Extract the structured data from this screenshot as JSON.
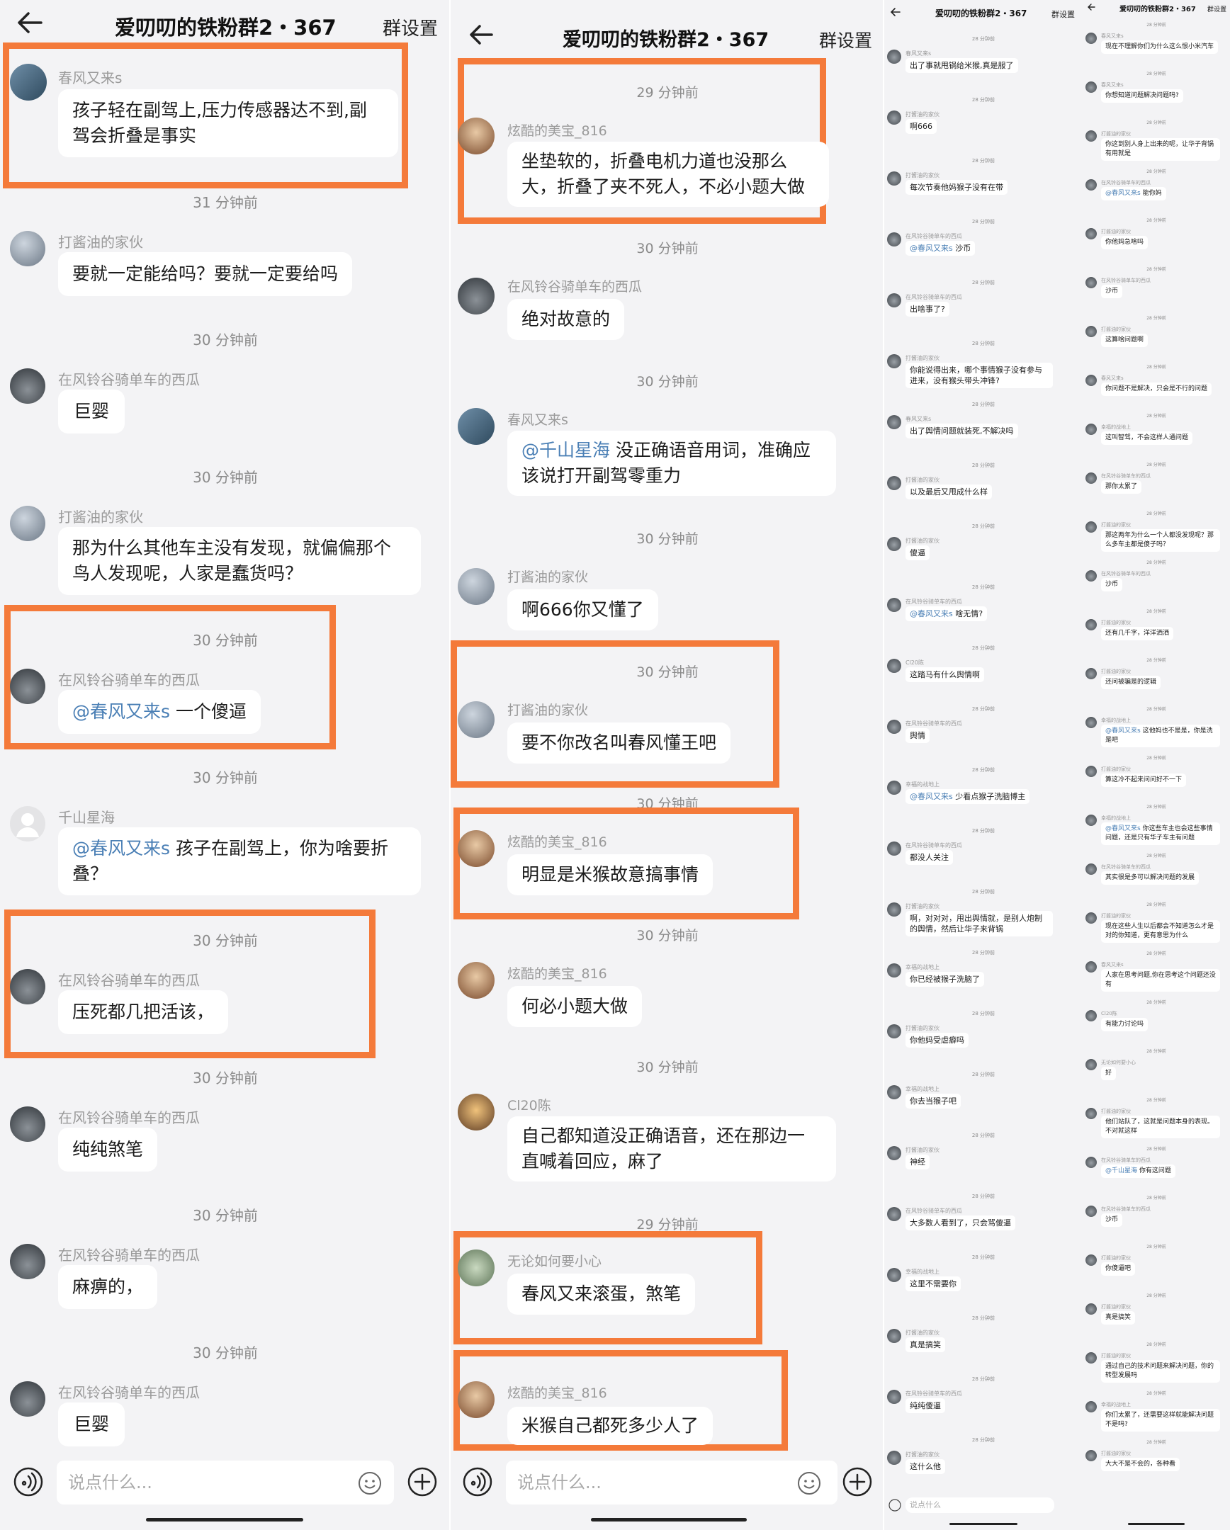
{
  "group": {
    "title": "爱叨叨的铁粉群2・367",
    "settings": "群设置"
  },
  "input": {
    "placeholder": "说点什么..."
  },
  "colors": {
    "highlight": "#f47a3a",
    "mention": "#4a7fb5",
    "bubble": "#ffffff",
    "background": "#f3f3f5"
  },
  "panel1": {
    "m1": {
      "sender": "春风又来s",
      "text": "孩子轻在副驾上,压力传感器达不到,副驾会折叠是事实"
    },
    "t1": "31 分钟前",
    "m2": {
      "sender": "打酱油的家伙",
      "text": "要就一定能给吗？要就一定要给吗"
    },
    "t2": "30 分钟前",
    "m3": {
      "sender": "在风铃谷骑单车的西瓜",
      "text": "巨婴"
    },
    "t3": "30 分钟前",
    "m4": {
      "sender": "打酱油的家伙",
      "text": "那为什么其他车主没有发现，就偏偏那个鸟人发现呢，人家是蠢货吗？"
    },
    "t4": "30 分钟前",
    "m5": {
      "sender": "在风铃谷骑单车的西瓜",
      "mention": "@春风又来s",
      "text": " 一个傻逼"
    },
    "t5": "30 分钟前",
    "m6": {
      "sender": "千山星海",
      "mention": "@春风又来s",
      "text": " 孩子在副驾上，你为啥要折叠？"
    },
    "t6": "30 分钟前",
    "m7": {
      "sender": "在风铃谷骑单车的西瓜",
      "text": "压死都几把活该，"
    },
    "t7": "30 分钟前",
    "m8": {
      "sender": "在风铃谷骑单车的西瓜",
      "text": "纯纯煞笔"
    },
    "t8": "30 分钟前",
    "m9": {
      "sender": "在风铃谷骑单车的西瓜",
      "text": "麻痹的，"
    },
    "t9": "30 分钟前",
    "m10": {
      "sender": "在风铃谷骑单车的西瓜",
      "text": "巨婴"
    }
  },
  "panel2": {
    "t1": "29 分钟前",
    "m1": {
      "sender": "炫酷的美宝_816",
      "text": "坐垫软的，折叠电机力道也没那么大，折叠了夹不死人，不必小题大做"
    },
    "t2": "30 分钟前",
    "m2": {
      "sender": "在风铃谷骑单车的西瓜",
      "text": "绝对故意的"
    },
    "t3": "30 分钟前",
    "m3": {
      "sender": "春风又来s",
      "mention": "@千山星海",
      "text": " 没正确语音用词，准确应该说打开副驾零重力"
    },
    "t4": "30 分钟前",
    "m4": {
      "sender": "打酱油的家伙",
      "text": "啊666你又懂了"
    },
    "t5": "30 分钟前",
    "m5": {
      "sender": "打酱油的家伙",
      "text": "要不你改名叫春风懂王吧"
    },
    "t6": "30 分钟前",
    "m6": {
      "sender": "炫酷的美宝_816",
      "text": "明显是米猴故意搞事情"
    },
    "t7": "30 分钟前",
    "m7": {
      "sender": "炫酷的美宝_816",
      "text": "何必小题大做"
    },
    "t8": "30 分钟前",
    "m8": {
      "sender": "Cl20陈",
      "text": "自己都知道没正确语音，还在那边一直喊着回应，麻了"
    },
    "t9": "29 分钟前",
    "m9": {
      "sender": "无论如何要小心",
      "text": "春风又来滚蛋，煞笔"
    },
    "m10": {
      "sender": "炫酷的美宝_816",
      "text": "米猴自己都死多少人了"
    }
  },
  "panel3": {
    "time": "28 分钟前",
    "items": [
      {
        "sender": "春风又来s",
        "text": "出了事就甩锅给米猴,真是服了"
      },
      {
        "sender": "打酱油的家伙",
        "text": "啊666"
      },
      {
        "sender": "打酱油的家伙",
        "text": "每次节奏他妈猴子没有在带"
      },
      {
        "sender": "在风铃谷骑单车的西瓜",
        "mention": "@春风又来s",
        "text": " 沙币"
      },
      {
        "sender": "在风铃谷骑单车的西瓜",
        "text": "出啥事了?"
      },
      {
        "sender": "打酱油的家伙",
        "text": "你能说得出来，哪个事情猴子没有参与进来，没有猴头带头冲锋?"
      },
      {
        "sender": "春风又来s",
        "text": "出了舆情问题就装死,不解决吗"
      },
      {
        "sender": "打酱油的家伙",
        "text": "以及最后又甩成什么样"
      },
      {
        "sender": "打酱油的家伙",
        "text": "傻逼"
      },
      {
        "sender": "在风铃谷骑单车的西瓜",
        "mention": "@春风又来s",
        "text": " 啥无情?"
      },
      {
        "sender": "Cl20陈",
        "text": "这踏马有什么舆情啊"
      },
      {
        "sender": "在风铃谷骑单车的西瓜",
        "text": "舆情"
      },
      {
        "sender": "幸福的战地上",
        "mention": "@春风又来s",
        "text": " 少看点猴子洗脑博主"
      },
      {
        "sender": "在风铃谷骑单车的西瓜",
        "text": "都没人关注"
      },
      {
        "sender": "打酱油的家伙",
        "text": "啊，对对对，甩出舆情就，是别人炮制的舆情，然后让华子来背锅"
      },
      {
        "sender": "幸福的战地上",
        "text": "你已经被猴子洗脑了"
      },
      {
        "sender": "打酱油的家伙",
        "text": "你他妈受虐癖吗"
      },
      {
        "sender": "幸福的战地上",
        "text": "你去当猴子吧"
      },
      {
        "sender": "打酱油的家伙",
        "text": "神经"
      },
      {
        "sender": "在风铃谷骑单车的西瓜",
        "text": "大多数人看到了，只会骂傻逼"
      },
      {
        "sender": "幸福的战地上",
        "text": "这里不需要你"
      },
      {
        "sender": "打酱油的家伙",
        "text": "真是搞笑"
      },
      {
        "sender": "在风铃谷骑单车的西瓜",
        "text": "纯纯傻逼"
      },
      {
        "sender": "打酱油的家伙",
        "text": "这什么他"
      }
    ],
    "input_placeholder": "说点什么"
  },
  "panel4": {
    "time": "28 分钟前",
    "items": [
      {
        "sender": "春风又来s",
        "text": "现在不理解你们为什么这么恨小米汽车"
      },
      {
        "sender": "春风又来s",
        "text": "你想知道问题解决问题吗?"
      },
      {
        "sender": "打酱油的家伙",
        "text": "你这到别人身上出来的呢，让华子背锅有用就是"
      },
      {
        "sender": "在风铃谷骑单车的西瓜",
        "mention": "@春风又来s",
        "text": " 能你妈"
      },
      {
        "sender": "打酱油的家伙",
        "text": "你他妈急啥吗"
      },
      {
        "sender": "在风铃谷骑单车的西瓜",
        "text": "沙币"
      },
      {
        "sender": "打酱油的家伙",
        "text": "这算啥问题啊"
      },
      {
        "sender": "春风又来s",
        "text": "你问题不是解决，只会是不行的问题"
      },
      {
        "sender": "幸福的战地上",
        "text": "这叫智驾，不会这样人通问题"
      },
      {
        "sender": "在风铃谷骑单车的西瓜",
        "text": "那你太累了"
      },
      {
        "sender": "打酱油的家伙",
        "text": "那这两年为什么一个人都没发现呢？那么多车主都是傻子吗？"
      },
      {
        "sender": "在风铃谷骑单车的西瓜",
        "text": "沙币"
      },
      {
        "sender": "打酱油的家伙",
        "text": "还有几千字，洋洋洒洒"
      },
      {
        "sender": "打酱油的家伙",
        "text": "还问被骗是的逻辑"
      },
      {
        "sender": "幸福的战地上",
        "mention": "@春风又来s",
        "text": " 这他妈也不是是，你是洗是吧"
      },
      {
        "sender": "打酱油的家伙",
        "text": "算这冷不起来问问好不一下"
      },
      {
        "sender": "幸福的战地上",
        "mention": "@春风又来s",
        "text": " 你这些车主也会这些事情问题，还是只有华子车主有问题"
      },
      {
        "sender": "在风铃谷骑单车的西瓜",
        "text": "其实很是多可以解决问题的发展"
      },
      {
        "sender": "打酱油的家伙",
        "text": "现在这些人生以后都会不知道怎么才是对的你知道，更有意思为什么"
      },
      {
        "sender": "春风又来s",
        "text": "人家在思考问题,你在思考这个问题还没有"
      },
      {
        "sender": "Cl20陈",
        "text": "有能力讨论吗"
      },
      {
        "sender": "无论如何要小心",
        "text": "好"
      },
      {
        "sender": "打酱油的家伙",
        "text": "他们站队了，这就是问题本身的表现。不对就这样"
      },
      {
        "sender": "在风铃谷骑单车的西瓜",
        "mention": "@千山星海",
        "text": " 你有这问题"
      },
      {
        "sender": "在风铃谷骑单车的西瓜",
        "text": "沙币"
      },
      {
        "sender": "打酱油的家伙",
        "text": "你傻逼吧"
      },
      {
        "sender": "打酱油的家伙",
        "text": "真是搞笑"
      },
      {
        "sender": "打酱油的家伙",
        "text": "通过自己的技术问题来解决问题，你的转型发展吗"
      },
      {
        "sender": "幸福的战地上",
        "text": "你们太累了，还需要这样就能解决问题不是吗?"
      },
      {
        "sender": "打酱油的家伙",
        "text": "大大不是不会的，各种看"
      }
    ]
  }
}
